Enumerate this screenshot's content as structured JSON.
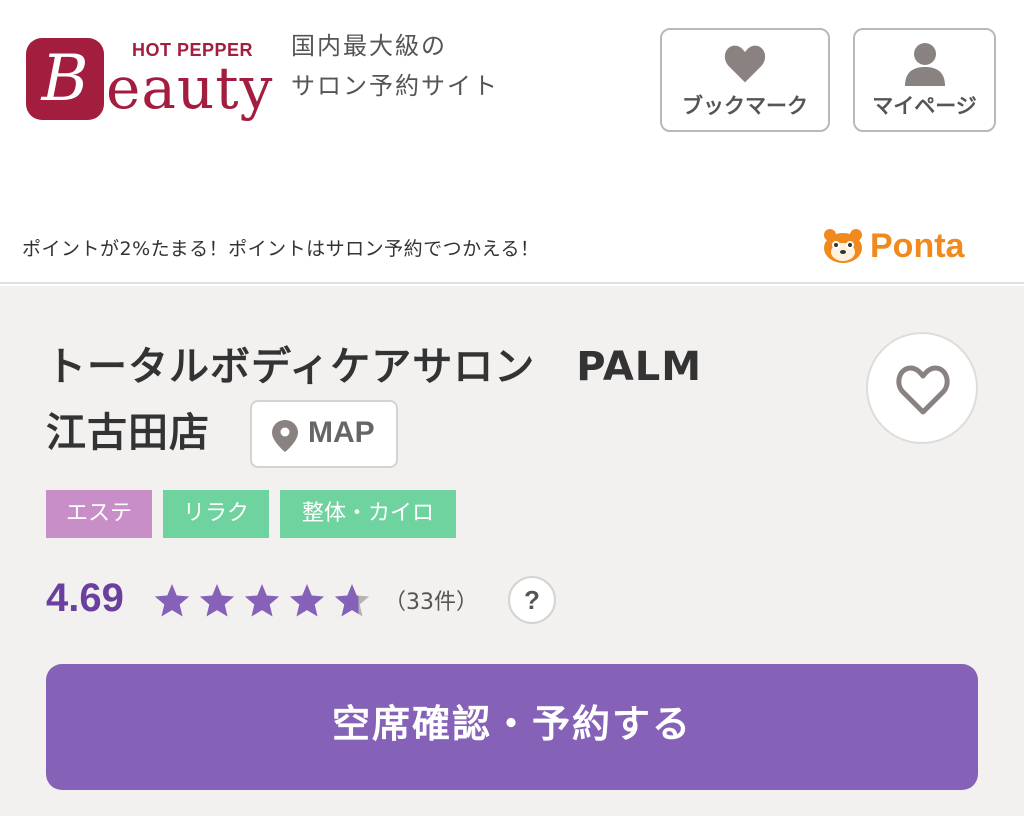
{
  "header": {
    "logo": {
      "brand": "HOT PEPPER",
      "initial": "B",
      "rest": "eauty"
    },
    "tagline_line1": "国内最大級の",
    "tagline_line2": "サロン予約サイト",
    "bookmark_label": "ブックマーク",
    "mypage_label": "マイページ"
  },
  "promo": {
    "text": "ポイントが2%たまる！ポイントはサロン予約でつかえる！",
    "logo_text": "Ponta"
  },
  "salon": {
    "name_line1": "トータルボディケアサロン　PALM",
    "name_line2": "江古田店",
    "map_label": "MAP",
    "tags": [
      "エステ",
      "リラク",
      "整体・カイロ"
    ],
    "rating": "4.69",
    "rating_value": 4.69,
    "stars_max": 5,
    "review_count": "（33件）",
    "help_label": "?",
    "reserve_label": "空席確認・予約する"
  },
  "colors": {
    "brand": "#a31d3f",
    "accent_purple": "#8561b8",
    "rating_purple": "#6b3fa0",
    "tag_este": "#c88ec7",
    "tag_green": "#6fd3a0",
    "ponta_orange": "#f08a1c"
  },
  "icons": {
    "bookmark": "heart-icon",
    "mypage": "person-icon",
    "map": "map-pin-icon",
    "favorite": "heart-outline-icon",
    "help": "question-icon"
  }
}
